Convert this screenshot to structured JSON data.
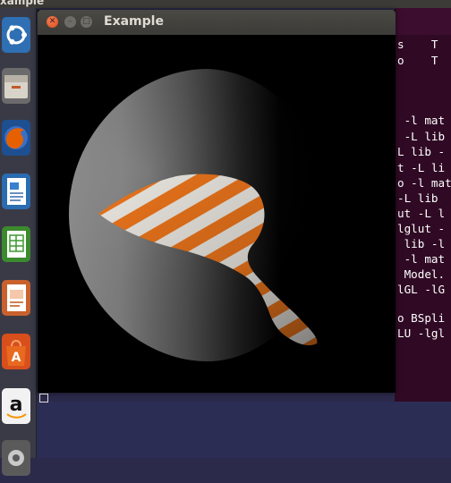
{
  "desktop": {
    "top_title": "xample"
  },
  "window": {
    "title": "Example"
  },
  "launcher": {
    "items": [
      {
        "name": "ubuntu-dash-icon"
      },
      {
        "name": "files-icon"
      },
      {
        "name": "firefox-icon"
      },
      {
        "name": "writer-icon"
      },
      {
        "name": "calc-icon"
      },
      {
        "name": "impress-icon"
      },
      {
        "name": "software-center-icon"
      },
      {
        "name": "amazon-icon"
      },
      {
        "name": "settings-icon"
      }
    ]
  },
  "terminal": {
    "lines": [
      "s    T",
      "o    T",
      "",
      "",
      " -l mat",
      " -L lib",
      "L lib -",
      "t -L li",
      "o -l mat",
      "-L lib ",
      "ut -L l",
      "lglut -",
      " lib -l",
      " -l mat",
      " Model.",
      "lGL -lG",
      "",
      "o BSpli",
      "LU -lgl"
    ]
  },
  "colors": {
    "terminal_bg": "#300a24",
    "launcher_bg": "#3a3a46",
    "close_button": "#df4a16",
    "stripe_orange": "#e8731b"
  }
}
